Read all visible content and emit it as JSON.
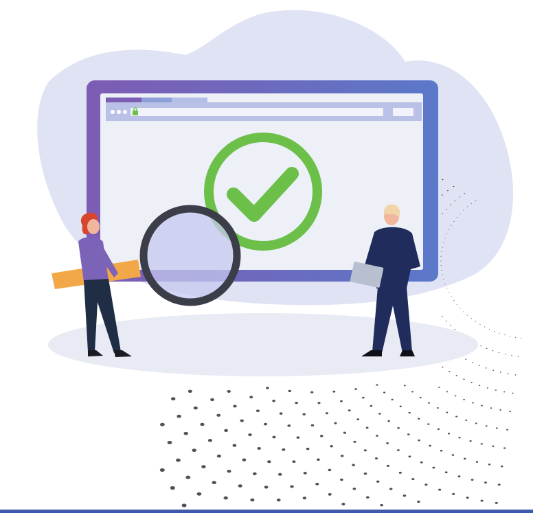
{
  "illustration": {
    "subject": "website-verification",
    "icons": [
      "browser-window-icon",
      "checkmark-circle-icon",
      "magnifying-glass-icon",
      "padlock-icon"
    ]
  },
  "colors": {
    "cloud": "#dfe3f3",
    "frame_left": "#7d5cb3",
    "frame_right": "#5b78c9",
    "screen": "#eef0f8",
    "check": "#6cc04a",
    "lens_ring": "#3b3d49",
    "lens_glass": "#c5c8ef",
    "handle": "#f2a848",
    "ground": "#e8eaf4",
    "woman_top": "#7b63b7",
    "woman_pants": "#1f2d45",
    "woman_hair": "#d8452f",
    "man_suit": "#1f2c5c",
    "man_hair": "#f1d5a8",
    "skin": "#f0b79d",
    "dots": "#4f5159",
    "bottom_strip": "#3f5aa8"
  }
}
